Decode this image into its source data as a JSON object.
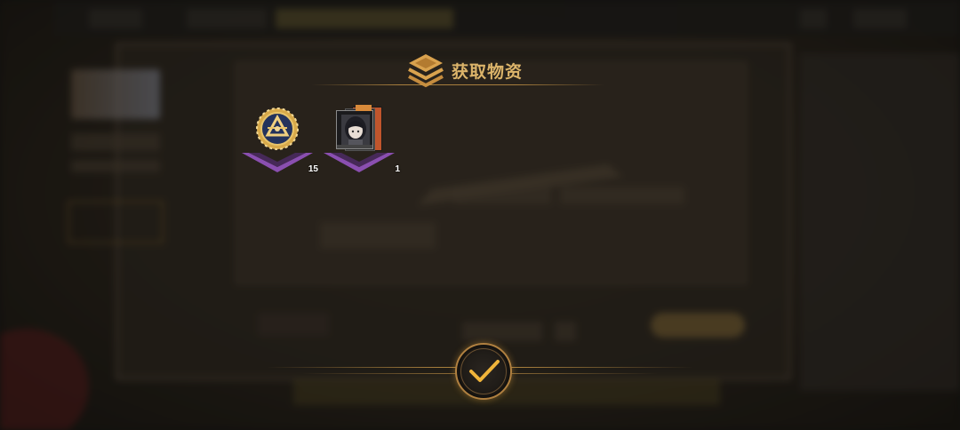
{
  "dialog": {
    "title": "获取物资",
    "title_icon": "stacked-layers-icon"
  },
  "rewards": [
    {
      "name": "gold-medal-token",
      "icon": "gold-emblem-icon",
      "count": "15"
    },
    {
      "name": "character-card",
      "icon": "character-portrait-card-icon",
      "count": "1"
    }
  ],
  "confirm": {
    "icon": "checkmark-icon"
  },
  "colors": {
    "accent_gold": "#dcb46a",
    "pedestal_purple": "#8a4fb0",
    "background_dark": "#151311"
  }
}
